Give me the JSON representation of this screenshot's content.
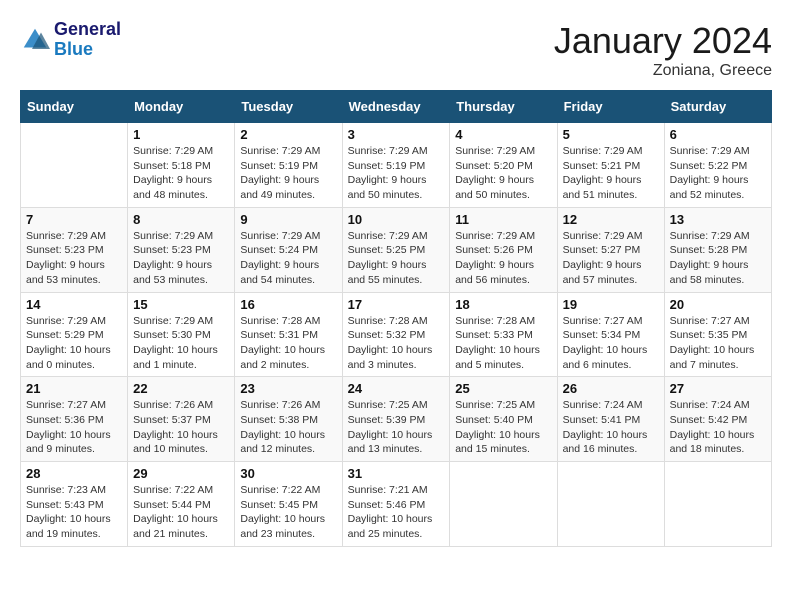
{
  "logo": {
    "text1": "General",
    "text2": "Blue"
  },
  "header": {
    "title": "January 2024",
    "subtitle": "Zoniana, Greece"
  },
  "weekdays": [
    "Sunday",
    "Monday",
    "Tuesday",
    "Wednesday",
    "Thursday",
    "Friday",
    "Saturday"
  ],
  "weeks": [
    [
      {
        "day": "",
        "sunrise": "",
        "sunset": "",
        "daylight": ""
      },
      {
        "day": "1",
        "sunrise": "Sunrise: 7:29 AM",
        "sunset": "Sunset: 5:18 PM",
        "daylight": "Daylight: 9 hours and 48 minutes."
      },
      {
        "day": "2",
        "sunrise": "Sunrise: 7:29 AM",
        "sunset": "Sunset: 5:19 PM",
        "daylight": "Daylight: 9 hours and 49 minutes."
      },
      {
        "day": "3",
        "sunrise": "Sunrise: 7:29 AM",
        "sunset": "Sunset: 5:19 PM",
        "daylight": "Daylight: 9 hours and 50 minutes."
      },
      {
        "day": "4",
        "sunrise": "Sunrise: 7:29 AM",
        "sunset": "Sunset: 5:20 PM",
        "daylight": "Daylight: 9 hours and 50 minutes."
      },
      {
        "day": "5",
        "sunrise": "Sunrise: 7:29 AM",
        "sunset": "Sunset: 5:21 PM",
        "daylight": "Daylight: 9 hours and 51 minutes."
      },
      {
        "day": "6",
        "sunrise": "Sunrise: 7:29 AM",
        "sunset": "Sunset: 5:22 PM",
        "daylight": "Daylight: 9 hours and 52 minutes."
      }
    ],
    [
      {
        "day": "7",
        "sunrise": "Sunrise: 7:29 AM",
        "sunset": "Sunset: 5:23 PM",
        "daylight": "Daylight: 9 hours and 53 minutes."
      },
      {
        "day": "8",
        "sunrise": "Sunrise: 7:29 AM",
        "sunset": "Sunset: 5:23 PM",
        "daylight": "Daylight: 9 hours and 53 minutes."
      },
      {
        "day": "9",
        "sunrise": "Sunrise: 7:29 AM",
        "sunset": "Sunset: 5:24 PM",
        "daylight": "Daylight: 9 hours and 54 minutes."
      },
      {
        "day": "10",
        "sunrise": "Sunrise: 7:29 AM",
        "sunset": "Sunset: 5:25 PM",
        "daylight": "Daylight: 9 hours and 55 minutes."
      },
      {
        "day": "11",
        "sunrise": "Sunrise: 7:29 AM",
        "sunset": "Sunset: 5:26 PM",
        "daylight": "Daylight: 9 hours and 56 minutes."
      },
      {
        "day": "12",
        "sunrise": "Sunrise: 7:29 AM",
        "sunset": "Sunset: 5:27 PM",
        "daylight": "Daylight: 9 hours and 57 minutes."
      },
      {
        "day": "13",
        "sunrise": "Sunrise: 7:29 AM",
        "sunset": "Sunset: 5:28 PM",
        "daylight": "Daylight: 9 hours and 58 minutes."
      }
    ],
    [
      {
        "day": "14",
        "sunrise": "Sunrise: 7:29 AM",
        "sunset": "Sunset: 5:29 PM",
        "daylight": "Daylight: 10 hours and 0 minutes."
      },
      {
        "day": "15",
        "sunrise": "Sunrise: 7:29 AM",
        "sunset": "Sunset: 5:30 PM",
        "daylight": "Daylight: 10 hours and 1 minute."
      },
      {
        "day": "16",
        "sunrise": "Sunrise: 7:28 AM",
        "sunset": "Sunset: 5:31 PM",
        "daylight": "Daylight: 10 hours and 2 minutes."
      },
      {
        "day": "17",
        "sunrise": "Sunrise: 7:28 AM",
        "sunset": "Sunset: 5:32 PM",
        "daylight": "Daylight: 10 hours and 3 minutes."
      },
      {
        "day": "18",
        "sunrise": "Sunrise: 7:28 AM",
        "sunset": "Sunset: 5:33 PM",
        "daylight": "Daylight: 10 hours and 5 minutes."
      },
      {
        "day": "19",
        "sunrise": "Sunrise: 7:27 AM",
        "sunset": "Sunset: 5:34 PM",
        "daylight": "Daylight: 10 hours and 6 minutes."
      },
      {
        "day": "20",
        "sunrise": "Sunrise: 7:27 AM",
        "sunset": "Sunset: 5:35 PM",
        "daylight": "Daylight: 10 hours and 7 minutes."
      }
    ],
    [
      {
        "day": "21",
        "sunrise": "Sunrise: 7:27 AM",
        "sunset": "Sunset: 5:36 PM",
        "daylight": "Daylight: 10 hours and 9 minutes."
      },
      {
        "day": "22",
        "sunrise": "Sunrise: 7:26 AM",
        "sunset": "Sunset: 5:37 PM",
        "daylight": "Daylight: 10 hours and 10 minutes."
      },
      {
        "day": "23",
        "sunrise": "Sunrise: 7:26 AM",
        "sunset": "Sunset: 5:38 PM",
        "daylight": "Daylight: 10 hours and 12 minutes."
      },
      {
        "day": "24",
        "sunrise": "Sunrise: 7:25 AM",
        "sunset": "Sunset: 5:39 PM",
        "daylight": "Daylight: 10 hours and 13 minutes."
      },
      {
        "day": "25",
        "sunrise": "Sunrise: 7:25 AM",
        "sunset": "Sunset: 5:40 PM",
        "daylight": "Daylight: 10 hours and 15 minutes."
      },
      {
        "day": "26",
        "sunrise": "Sunrise: 7:24 AM",
        "sunset": "Sunset: 5:41 PM",
        "daylight": "Daylight: 10 hours and 16 minutes."
      },
      {
        "day": "27",
        "sunrise": "Sunrise: 7:24 AM",
        "sunset": "Sunset: 5:42 PM",
        "daylight": "Daylight: 10 hours and 18 minutes."
      }
    ],
    [
      {
        "day": "28",
        "sunrise": "Sunrise: 7:23 AM",
        "sunset": "Sunset: 5:43 PM",
        "daylight": "Daylight: 10 hours and 19 minutes."
      },
      {
        "day": "29",
        "sunrise": "Sunrise: 7:22 AM",
        "sunset": "Sunset: 5:44 PM",
        "daylight": "Daylight: 10 hours and 21 minutes."
      },
      {
        "day": "30",
        "sunrise": "Sunrise: 7:22 AM",
        "sunset": "Sunset: 5:45 PM",
        "daylight": "Daylight: 10 hours and 23 minutes."
      },
      {
        "day": "31",
        "sunrise": "Sunrise: 7:21 AM",
        "sunset": "Sunset: 5:46 PM",
        "daylight": "Daylight: 10 hours and 25 minutes."
      },
      {
        "day": "",
        "sunrise": "",
        "sunset": "",
        "daylight": ""
      },
      {
        "day": "",
        "sunrise": "",
        "sunset": "",
        "daylight": ""
      },
      {
        "day": "",
        "sunrise": "",
        "sunset": "",
        "daylight": ""
      }
    ]
  ]
}
